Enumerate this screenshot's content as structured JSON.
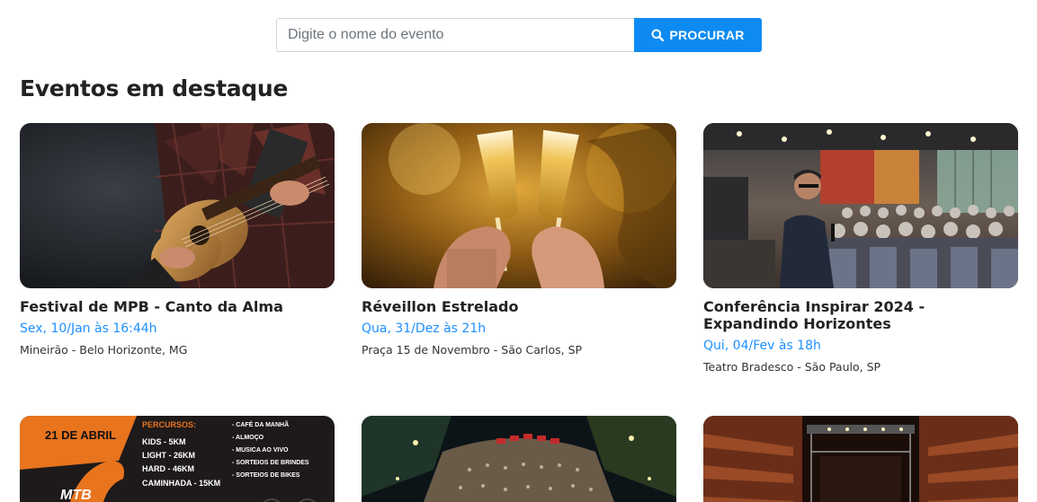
{
  "search": {
    "placeholder": "Digite o nome do evento",
    "value": "",
    "button_label": "PROCURAR",
    "button_icon": "search-icon"
  },
  "section": {
    "title": "Eventos em destaque"
  },
  "events": [
    {
      "title": "Festival de MPB - Canto da Alma",
      "date": "Sex, 10/Jan às 16:44h",
      "location": "Mineirão - Belo Horizonte, MG"
    },
    {
      "title": "Réveillon Estrelado",
      "date": "Qua, 31/Dez às 21h",
      "location": "Praça 15 de Novembro - São Carlos, SP"
    },
    {
      "title": "Conferência Inspirar 2024 - Expandindo Horizontes",
      "date": "Qui, 04/Fev às 18h",
      "location": "Teatro Bradesco - São Paulo, SP"
    }
  ],
  "poster": {
    "date": "21 DE ABRIL",
    "heading": "PERCURSOS:",
    "routes": [
      "KIDS - 5KM",
      "LIGHT - 26KM",
      "HARD - 46KM",
      "CAMINHADA - 15KM"
    ],
    "perks": [
      "- CAFÉ DA MANHÃ",
      "- ALMOÇO",
      "- MUSICA AO VIVO",
      "- SORTEIOS DE BRINDES",
      "- SORTEIOS DE BIKES"
    ],
    "logo": "MTB"
  },
  "colors": {
    "accent": "#0d8bf2",
    "date_text": "#1e90ff"
  }
}
